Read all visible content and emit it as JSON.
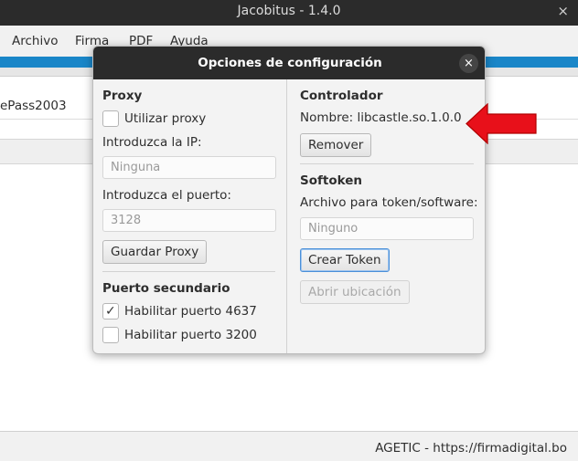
{
  "window": {
    "title": "Jacobitus - 1.4.0",
    "close_glyph": "×"
  },
  "menu": {
    "items": [
      "Archivo",
      "Firma",
      "PDF",
      "Ayuda"
    ]
  },
  "list": {
    "row_text": "ePass2003"
  },
  "status": {
    "text": "AGETIC - https://firmadigital.bo"
  },
  "dialog": {
    "title": "Opciones de configuración",
    "close_glyph": "×",
    "proxy": {
      "heading": "Proxy",
      "use_proxy_label": "Utilizar proxy",
      "use_proxy_checked": false,
      "ip_label": "Introduzca la IP:",
      "ip_placeholder": "Ninguna",
      "port_label": "Introduzca el puerto:",
      "port_placeholder": "3128",
      "save_button": "Guardar Proxy"
    },
    "secondary_port": {
      "heading": "Puerto secundario",
      "port_4637_label": "Habilitar puerto 4637",
      "port_4637_checked": true,
      "port_3200_label": "Habilitar puerto 3200",
      "port_3200_checked": false,
      "check_glyph": "✓"
    },
    "controller": {
      "heading": "Controlador",
      "name_text": "Nombre: libcastle.so.1.0.0",
      "remove_button": "Remover"
    },
    "softoken": {
      "heading": "Softoken",
      "file_label": "Archivo para token/software:",
      "file_placeholder": "Ninguno",
      "create_button": "Crear Token",
      "open_location_button": "Abrir ubicación"
    }
  },
  "colors": {
    "accent_blue": "#1a86c8",
    "arrow_red": "#e8101a",
    "titlebar_dark": "#2b2b2b"
  }
}
